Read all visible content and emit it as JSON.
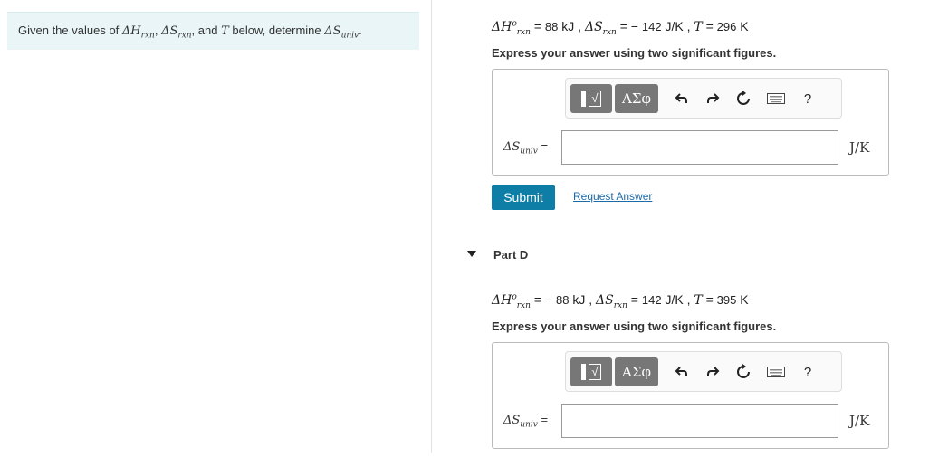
{
  "intro": {
    "prefix": "Given the values of ",
    "dh_sym": "ΔH",
    "dh_sub": "rxn",
    "sep1": ", ",
    "ds_sym": "ΔS",
    "ds_sub": "rxn",
    "sep2": ", and ",
    "t_sym": "T",
    "mid": " below, determine ",
    "dsu_sym": "ΔS",
    "dsu_sub": "univ",
    "end": "."
  },
  "part_c": {
    "dh_sym": "ΔH",
    "dh_sup": "o",
    "dh_sub": "rxn",
    "eq1": " = ",
    "dh_val": "88",
    "dh_unit": " kJ , ",
    "ds_sym": "ΔS",
    "ds_sub": "rxn",
    "eq2": " = − ",
    "ds_val": "142",
    "ds_unit": " J/K , ",
    "t_sym": "T",
    "eq3": " = ",
    "t_val": "296",
    "t_unit": " K",
    "instruction": "Express your answer using two significant figures.",
    "lhs_sym": "ΔS",
    "lhs_sub": "univ",
    "lhs_eq": " =",
    "unit": "J/K",
    "submit": "Submit",
    "request": "Request Answer"
  },
  "part_d": {
    "title": "Part D",
    "dh_sym": "ΔH",
    "dh_sup": "o",
    "dh_sub": "rxn",
    "eq1": " = − ",
    "dh_val": "88",
    "dh_unit": " kJ , ",
    "ds_sym": "ΔS",
    "ds_sub": "rxn",
    "eq2": " = ",
    "ds_val": "142",
    "ds_unit": " J/K , ",
    "t_sym": "T",
    "eq3": " = ",
    "t_val": "395",
    "t_unit": " K",
    "instruction": "Express your answer using two significant figures.",
    "lhs_sym": "ΔS",
    "lhs_sub": "univ",
    "lhs_eq": " =",
    "unit": "J/K"
  },
  "toolbar": {
    "templates_sqrt": "√",
    "greek_label": "ΑΣφ",
    "help_label": "?",
    "icons": [
      "templates-icon",
      "greek-symbols-icon",
      "undo-icon",
      "redo-icon",
      "reset-icon",
      "keyboard-icon",
      "help-icon"
    ]
  }
}
